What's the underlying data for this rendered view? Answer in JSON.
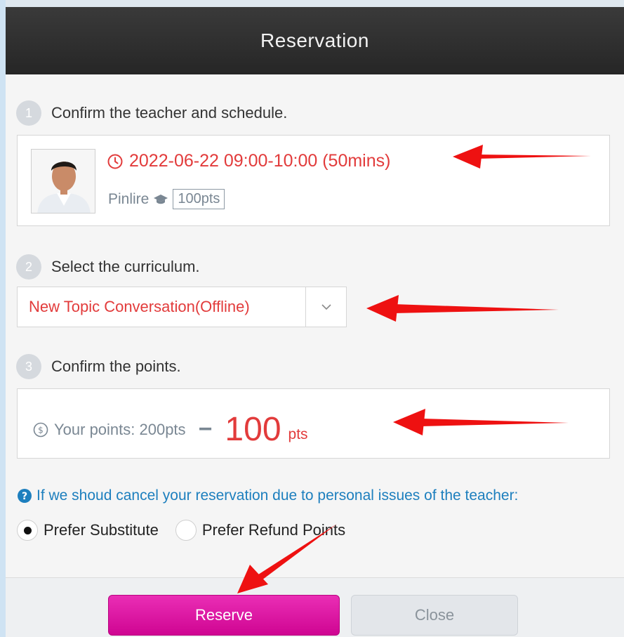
{
  "dialog": {
    "title": "Reservation"
  },
  "steps": [
    {
      "number": "1",
      "text": "Confirm the teacher and schedule."
    },
    {
      "number": "2",
      "text": "Select the curriculum."
    },
    {
      "number": "3",
      "text": "Confirm the points."
    }
  ],
  "teacher": {
    "schedule": "2022-06-22 09:00-10:00 (50mins)",
    "name": "Pinlire",
    "points_tag": "100pts"
  },
  "curriculum": {
    "selected": "New Topic Conversation(Offline)"
  },
  "points": {
    "your_points_label": "Your points: 200pts",
    "minus": "−",
    "deduct_value": "100",
    "deduct_unit": "pts"
  },
  "notice": {
    "text": "If we shoud cancel your reservation due to personal issues of the teacher:"
  },
  "options": [
    {
      "label": "Prefer Substitute",
      "selected": true
    },
    {
      "label": "Prefer Refund Points",
      "selected": false
    }
  ],
  "buttons": {
    "reserve": "Reserve",
    "close": "Close"
  },
  "colors": {
    "accent_red": "#e23b3b",
    "reserve_magenta": "#d8089c",
    "link_blue": "#1d7fbe",
    "header_dark": "#2e2e2e",
    "annotation_arrow": "#ee1111"
  }
}
